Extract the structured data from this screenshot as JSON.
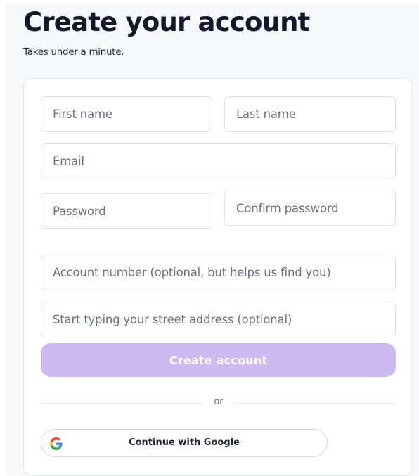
{
  "header": {
    "title": "Create your account",
    "subtitle": "Takes under a minute."
  },
  "form": {
    "first_name_placeholder": "First name",
    "last_name_placeholder": "Last name",
    "email_placeholder": "Email",
    "password_placeholder": "Password",
    "confirm_password_placeholder": "Confirm password",
    "account_number_placeholder": "Account number (optional, but helps us find you)",
    "address_placeholder": "Start typing your street address (optional)",
    "submit_label": "Create account",
    "divider_text": "or",
    "google_label": "Continue with Google"
  },
  "colors": {
    "primary_button": "#cdbaf1",
    "page_background": "#f6f8fb",
    "placeholder_text": "#6b7280"
  }
}
